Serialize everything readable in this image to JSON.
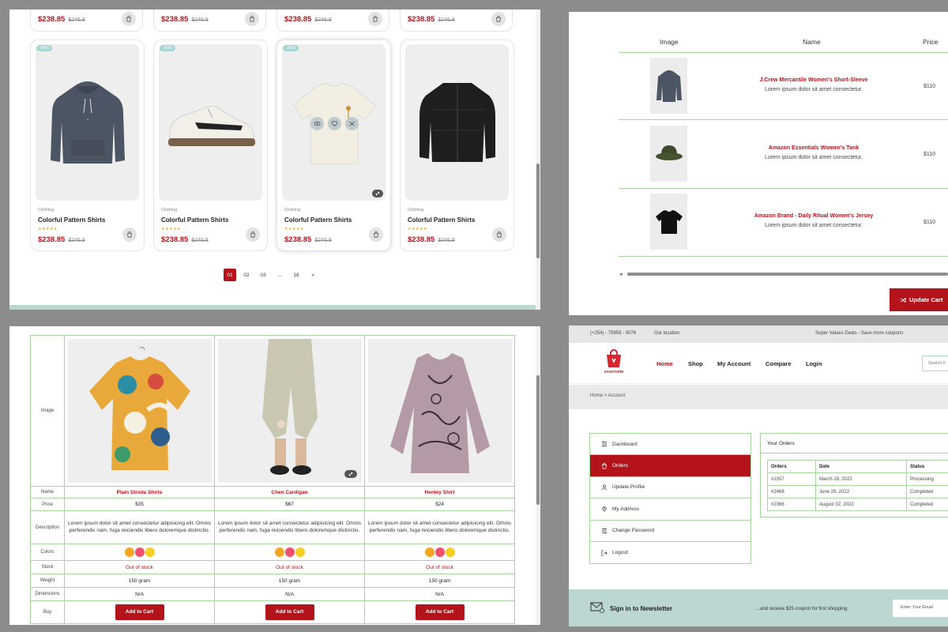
{
  "product_grid": {
    "prev_row": [
      {
        "price": "$238.85",
        "old_price": "$245.8"
      },
      {
        "price": "$238.85",
        "old_price": "$245.8"
      },
      {
        "price": "$238.85",
        "old_price": "$245.8"
      },
      {
        "price": "$238.85",
        "old_price": "$245.8"
      }
    ],
    "cards": [
      {
        "badge": "-20%",
        "category": "Clothing",
        "name": "Colorful Pattern Shirts",
        "stars": "★★★★★",
        "price": "$238.85",
        "old_price": "$245.8",
        "image": "hoodie"
      },
      {
        "badge": "-20%",
        "category": "Clothing",
        "name": "Colorful Pattern Shirts",
        "stars": "★★★★★",
        "price": "$238.85",
        "old_price": "$245.8",
        "image": "sneakers"
      },
      {
        "badge": "-20%",
        "category": "Clothing",
        "name": "Colorful Pattern Shirts",
        "stars": "★★★★★",
        "price": "$238.85",
        "old_price": "$245.8",
        "image": "tshirt"
      },
      {
        "badge": "",
        "category": "Clothing",
        "name": "Colorful Pattern Shirts",
        "stars": "★★★★★",
        "price": "$238.85",
        "old_price": "$245.8",
        "image": "jacket"
      }
    ],
    "pagination": {
      "pages": [
        "01",
        "02",
        "03",
        "...",
        "16"
      ],
      "active": "01",
      "next": "»"
    }
  },
  "cart": {
    "headers": {
      "image": "Image",
      "name": "Name",
      "price": "Price"
    },
    "rows": [
      {
        "title": "J.Crew Mercantile Women's Short-Sleeve",
        "desc": "Lorem ipsum dolor sit amet consectetur.",
        "price": "$110",
        "image": "hoodie"
      },
      {
        "title": "Amazon Essentials Women's Tank",
        "desc": "Lorem ipsum dolor sit amet consectetur.",
        "price": "$110",
        "image": "bucket-hat"
      },
      {
        "title": "Amazon Brand - Daily Ritual Women's Jersey",
        "desc": "Lorem ipsum dolor sit amet consectetur.",
        "price": "$110",
        "image": "black-tshirt"
      }
    ],
    "update_button": "Update Cart"
  },
  "compare": {
    "labels": {
      "image": "Image",
      "name": "Name",
      "price": "Price",
      "description": "Description",
      "colors": "Colors",
      "stock": "Stock",
      "weight": "Weight",
      "dimensions": "Dimensions",
      "buy": "Buy"
    },
    "products": [
      {
        "name": "Plain Striola Shirts",
        "price": "$35",
        "description": "Lorem ipsum dolor sit amet consectetur adipisicing elit. Omnis perferendis nam, fuga reiciendis libero doloremque distinctio.",
        "stock": "Out of stock",
        "weight": "150 gram",
        "dimensions": "N/A",
        "buy": "Add to Cart",
        "colors": [
          "#f5a623",
          "#f0506e",
          "#f5d020"
        ]
      },
      {
        "name": "Chen Cardigan",
        "price": "$67",
        "description": "Lorem ipsum dolor sit amet consectetur adipisicing elit. Omnis perferendis nam, fuga reiciendis libero doloremque distinctio.",
        "stock": "Out of stock",
        "weight": "150 gram",
        "dimensions": "N/A",
        "buy": "Add to Cart",
        "colors": [
          "#f5a623",
          "#f0506e",
          "#f5d020"
        ]
      },
      {
        "name": "Henley Shirt",
        "price": "$24",
        "description": "Lorem ipsum dolor sit amet consectetur adipisicing elit. Omnis perferendis nam, fuga reiciendis libero doloremque distinctio.",
        "stock": "Out of stock",
        "weight": "150 gram",
        "dimensions": "N/A",
        "buy": "Add to Cart",
        "colors": [
          "#f5a623",
          "#f0506e",
          "#f5d020"
        ]
      }
    ]
  },
  "account": {
    "topbar": {
      "phone": "(+254) - 79958 - 9076",
      "location": "Our location",
      "promo": "Super Values Deals - Save more coupons"
    },
    "logo_text": "SANSTORE",
    "nav": [
      "Home",
      "Shop",
      "My Account",
      "Compare",
      "Login"
    ],
    "search_placeholder": "Search F",
    "breadcrumb": "Home  >  Account",
    "sidebar": [
      "Dashboard",
      "Orders",
      "Update Profile",
      "My Address",
      "Change Password",
      "Logout"
    ],
    "orders": {
      "title": "Your Orders",
      "headers": [
        "Orders",
        "Date",
        "Status"
      ],
      "rows": [
        [
          "#1357",
          "March 19, 2022",
          "Processing"
        ],
        [
          "#2468",
          "June 29, 2022",
          "Completed"
        ],
        [
          "#2366",
          "August 02, 2022",
          "Completed"
        ]
      ]
    },
    "newsletter": {
      "title": "Sign in to Newsletter",
      "subtitle": "...and receive $25 coupon for first shopping.",
      "placeholder": "Enter Your Email"
    }
  },
  "colors": {
    "accent": "#b3141c",
    "table_border": "#a7d4a1",
    "band": "#bcd6d1"
  }
}
